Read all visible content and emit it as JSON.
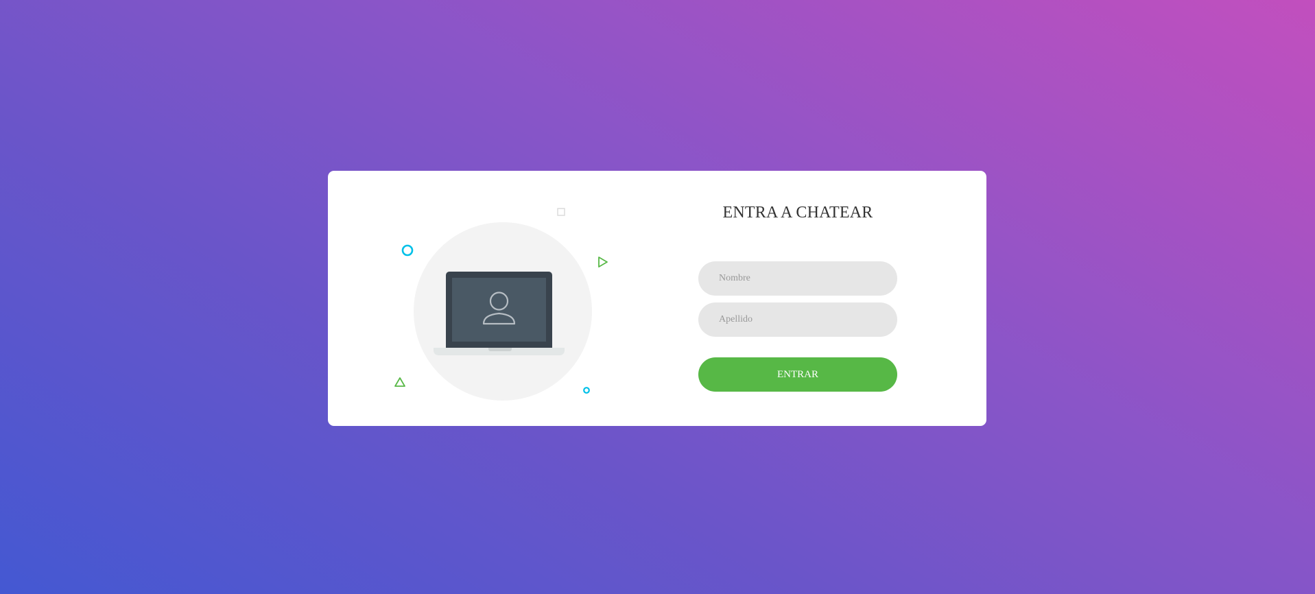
{
  "login_card": {
    "title": "ENTRA A CHATEAR",
    "first_name_field": {
      "placeholder": "Nombre",
      "value": ""
    },
    "last_name_field": {
      "placeholder": "Apellido",
      "value": ""
    },
    "submit_label": "ENTRAR"
  },
  "illustration": {
    "main_icon": "laptop-user-icon",
    "decorations": [
      "circle-icon",
      "square-icon",
      "triangle-right-icon",
      "triangle-up-icon",
      "small-circle-icon"
    ]
  },
  "colors": {
    "accent_green": "#57b846",
    "cyan_decoration": "#00c0e8",
    "green_decoration": "#57b846",
    "card_background": "#ffffff",
    "input_background": "#e6e6e6",
    "gradient_start": "#4458d2",
    "gradient_end": "#c24fbe"
  }
}
